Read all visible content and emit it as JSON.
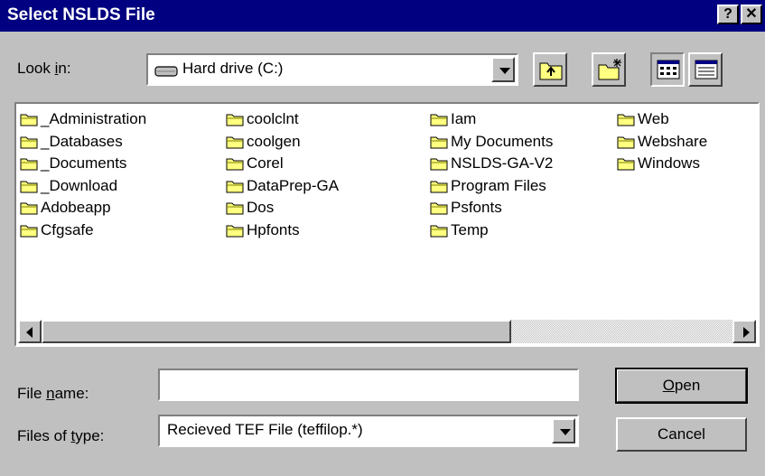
{
  "window": {
    "title": "Select NSLDS File",
    "help_label": "?",
    "close_label": "✕"
  },
  "lookin": {
    "label_pre": "Look ",
    "label_u": "i",
    "label_post": "n:",
    "value": "Hard drive (C:)"
  },
  "toolbar": {
    "icons": [
      "up-one-level-icon",
      "create-new-folder-icon",
      "list-view-icon",
      "details-view-icon"
    ]
  },
  "files": [
    "_Administration",
    "_Databases",
    "_Documents",
    "_Download",
    "Adobeapp",
    "Cfgsafe",
    "coolclnt",
    "coolgen",
    "Corel",
    "DataPrep-GA",
    "Dos",
    "Hpfonts",
    "Iam",
    "My Documents",
    "NSLDS-GA-V2",
    "Program Files",
    "Psfonts",
    "Temp",
    "Web",
    "Webshare",
    "Windows"
  ],
  "filename": {
    "label_pre": "File ",
    "label_u": "n",
    "label_post": "ame:",
    "value": ""
  },
  "filetype": {
    "label_pre": "Files of ",
    "label_u": "t",
    "label_post": "ype:",
    "value": "Recieved TEF File (teffilop.*)"
  },
  "buttons": {
    "open_u": "O",
    "open_rest": "pen",
    "cancel": "Cancel"
  },
  "colors": {
    "titlebar": "#000080",
    "face": "#c0c0c0",
    "folder": "#ffff80"
  }
}
